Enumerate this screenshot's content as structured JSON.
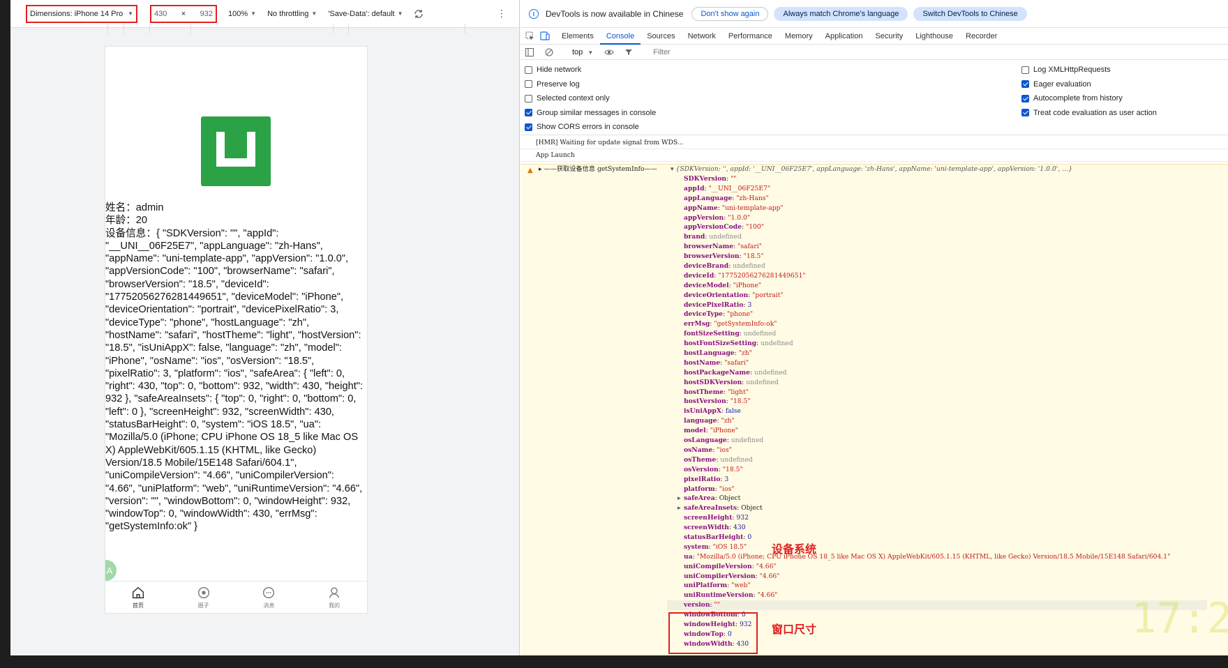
{
  "emulation": {
    "device_label": "Dimensions: iPhone 14 Pro Max",
    "width": "430",
    "times": "×",
    "height": "932",
    "zoom": "100%",
    "throttling": "No throttling",
    "save_data": "'Save-Data': default"
  },
  "phone": {
    "name_line": "姓名：admin",
    "age_line": "年龄：20",
    "device_info_text": "设备信息：{ \"SDKVersion\": \"\", \"appId\": \"__UNI__06F25E7\", \"appLanguage\": \"zh-Hans\", \"appName\": \"uni-template-app\", \"appVersion\": \"1.0.0\", \"appVersionCode\": \"100\", \"browserName\": \"safari\", \"browserVersion\": \"18.5\", \"deviceId\": \"17752056276281449651\", \"deviceModel\": \"iPhone\", \"deviceOrientation\": \"portrait\", \"devicePixelRatio\": 3, \"deviceType\": \"phone\", \"hostLanguage\": \"zh\", \"hostName\": \"safari\", \"hostTheme\": \"light\", \"hostVersion\": \"18.5\", \"isUniAppX\": false, \"language\": \"zh\", \"model\": \"iPhone\", \"osName\": \"ios\", \"osVersion\": \"18.5\", \"pixelRatio\": 3, \"platform\": \"ios\", \"safeArea\": { \"left\": 0, \"right\": 430, \"top\": 0, \"bottom\": 932, \"width\": 430, \"height\": 932 }, \"safeAreaInsets\": { \"top\": 0, \"right\": 0, \"bottom\": 0, \"left\": 0 }, \"screenHeight\": 932, \"screenWidth\": 430, \"statusBarHeight\": 0, \"system\": \"iOS 18.5\", \"ua\": \"Mozilla/5.0 (iPhone; CPU iPhone OS 18_5 like Mac OS X) AppleWebKit/605.1.15 (KHTML, like Gecko) Version/18.5 Mobile/15E148 Safari/604.1\", \"uniCompileVersion\": \"4.66\", \"uniCompilerVersion\": \"4.66\", \"uniPlatform\": \"web\", \"uniRuntimeVersion\": \"4.66\", \"version\": \"\", \"windowBottom\": 0, \"windowHeight\": 932, \"windowTop\": 0, \"windowWidth\": 430, \"errMsg\": \"getSystemInfo:ok\" }",
    "fab_label": "A",
    "tabs": [
      "首页",
      "圈子",
      "消息",
      "我的"
    ]
  },
  "devtools": {
    "info_text": "DevTools is now available in Chinese",
    "btn_dont_show": "Don't show again",
    "btn_always_match": "Always match Chrome's language",
    "btn_switch": "Switch DevTools to Chinese",
    "tabs": [
      "Elements",
      "Console",
      "Sources",
      "Network",
      "Performance",
      "Memory",
      "Application",
      "Security",
      "Lighthouse",
      "Recorder"
    ],
    "context": "top",
    "filter_placeholder": "Filter",
    "settings_left": [
      {
        "label": "Hide network",
        "checked": false
      },
      {
        "label": "Preserve log",
        "checked": false
      },
      {
        "label": "Selected context only",
        "checked": false
      },
      {
        "label": "Group similar messages in console",
        "checked": true
      },
      {
        "label": "Show CORS errors in console",
        "checked": true
      }
    ],
    "settings_right": [
      {
        "label": "Log XMLHttpRequests",
        "checked": false
      },
      {
        "label": "Eager evaluation",
        "checked": true
      },
      {
        "label": "Autocomplete from history",
        "checked": true
      },
      {
        "label": "Treat code evaluation as user action",
        "checked": true
      }
    ],
    "messages": [
      "[HMR] Waiting for update signal from WDS...",
      "App Launch"
    ],
    "warn_label": "▸ ——获取设备信息 getSystemInfo——",
    "warn_summary": "▾ {SDKVersion: '', appId: '__UNI__06F25E7', appLanguage: 'zh-Hans', appName: 'uni-template-app', appVersion: '1.0.0', …}",
    "properties": [
      {
        "k": "SDKVersion",
        "v": "\"\"",
        "t": "s"
      },
      {
        "k": "appId",
        "v": "\"__UNI__06F25E7\"",
        "t": "s"
      },
      {
        "k": "appLanguage",
        "v": "\"zh-Hans\"",
        "t": "s"
      },
      {
        "k": "appName",
        "v": "\"uni-template-app\"",
        "t": "s"
      },
      {
        "k": "appVersion",
        "v": "\"1.0.0\"",
        "t": "s"
      },
      {
        "k": "appVersionCode",
        "v": "\"100\"",
        "t": "s"
      },
      {
        "k": "brand",
        "v": "undefined",
        "t": "u"
      },
      {
        "k": "browserName",
        "v": "\"safari\"",
        "t": "s"
      },
      {
        "k": "browserVersion",
        "v": "\"18.5\"",
        "t": "s"
      },
      {
        "k": "deviceBrand",
        "v": "undefined",
        "t": "u"
      },
      {
        "k": "deviceId",
        "v": "\"17752056276281449651\"",
        "t": "s"
      },
      {
        "k": "deviceModel",
        "v": "\"iPhone\"",
        "t": "s"
      },
      {
        "k": "deviceOrientation",
        "v": "\"portrait\"",
        "t": "s"
      },
      {
        "k": "devicePixelRatio",
        "v": "3",
        "t": "n"
      },
      {
        "k": "deviceType",
        "v": "\"phone\"",
        "t": "s"
      },
      {
        "k": "errMsg",
        "v": "\"getSystemInfo:ok\"",
        "t": "s"
      },
      {
        "k": "fontSizeSetting",
        "v": "undefined",
        "t": "u"
      },
      {
        "k": "hostFontSizeSetting",
        "v": "undefined",
        "t": "u"
      },
      {
        "k": "hostLanguage",
        "v": "\"zh\"",
        "t": "s"
      },
      {
        "k": "hostName",
        "v": "\"safari\"",
        "t": "s"
      },
      {
        "k": "hostPackageName",
        "v": "undefined",
        "t": "u"
      },
      {
        "k": "hostSDKVersion",
        "v": "undefined",
        "t": "u"
      },
      {
        "k": "hostTheme",
        "v": "\"light\"",
        "t": "s"
      },
      {
        "k": "hostVersion",
        "v": "\"18.5\"",
        "t": "s"
      },
      {
        "k": "isUniAppX",
        "v": "false",
        "t": "b"
      },
      {
        "k": "language",
        "v": "\"zh\"",
        "t": "s"
      },
      {
        "k": "model",
        "v": "\"iPhone\"",
        "t": "s"
      },
      {
        "k": "osLanguage",
        "v": "undefined",
        "t": "u"
      },
      {
        "k": "osName",
        "v": "\"ios\"",
        "t": "s"
      },
      {
        "k": "osTheme",
        "v": "undefined",
        "t": "u"
      },
      {
        "k": "osVersion",
        "v": "\"18.5\"",
        "t": "s"
      },
      {
        "k": "pixelRatio",
        "v": "3",
        "t": "n"
      },
      {
        "k": "platform",
        "v": "\"ios\"",
        "t": "s"
      },
      {
        "k": "safeArea",
        "v": "Object",
        "t": "o",
        "tri": true
      },
      {
        "k": "safeAreaInsets",
        "v": "Object",
        "t": "o",
        "tri": true
      },
      {
        "k": "screenHeight",
        "v": "932",
        "t": "n"
      },
      {
        "k": "screenWidth",
        "v": "430",
        "t": "n"
      },
      {
        "k": "statusBarHeight",
        "v": "0",
        "t": "n"
      },
      {
        "k": "system",
        "v": "\"iOS 18.5\"",
        "t": "s"
      },
      {
        "k": "ua",
        "v": "\"Mozilla/5.0 (iPhone; CPU iPhone OS 18_5 like Mac OS X) AppleWebKit/605.1.15 (KHTML, like Gecko) Version/18.5 Mobile/15E148 Safari/604.1\"",
        "t": "s"
      },
      {
        "k": "uniCompileVersion",
        "v": "\"4.66\"",
        "t": "s"
      },
      {
        "k": "uniCompilerVersion",
        "v": "\"4.66\"",
        "t": "s"
      },
      {
        "k": "uniPlatform",
        "v": "\"web\"",
        "t": "s"
      },
      {
        "k": "uniRuntimeVersion",
        "v": "\"4.66\"",
        "t": "s"
      },
      {
        "k": "version",
        "v": "\"\"",
        "t": "s",
        "hl": true
      },
      {
        "k": "windowBottom",
        "v": "0",
        "t": "n"
      },
      {
        "k": "windowHeight",
        "v": "932",
        "t": "n"
      },
      {
        "k": "windowTop",
        "v": "0",
        "t": "n"
      },
      {
        "k": "windowWidth",
        "v": "430",
        "t": "n"
      }
    ]
  },
  "annotations": {
    "device_system": "设备系统",
    "window_size": "窗口尺寸"
  },
  "colors": {
    "accent": "#0b57d0",
    "logo_green": "#2ba246",
    "annotation_red": "#e02020",
    "warning_bg": "#fffbe5"
  },
  "overlay_clock": "17:2"
}
